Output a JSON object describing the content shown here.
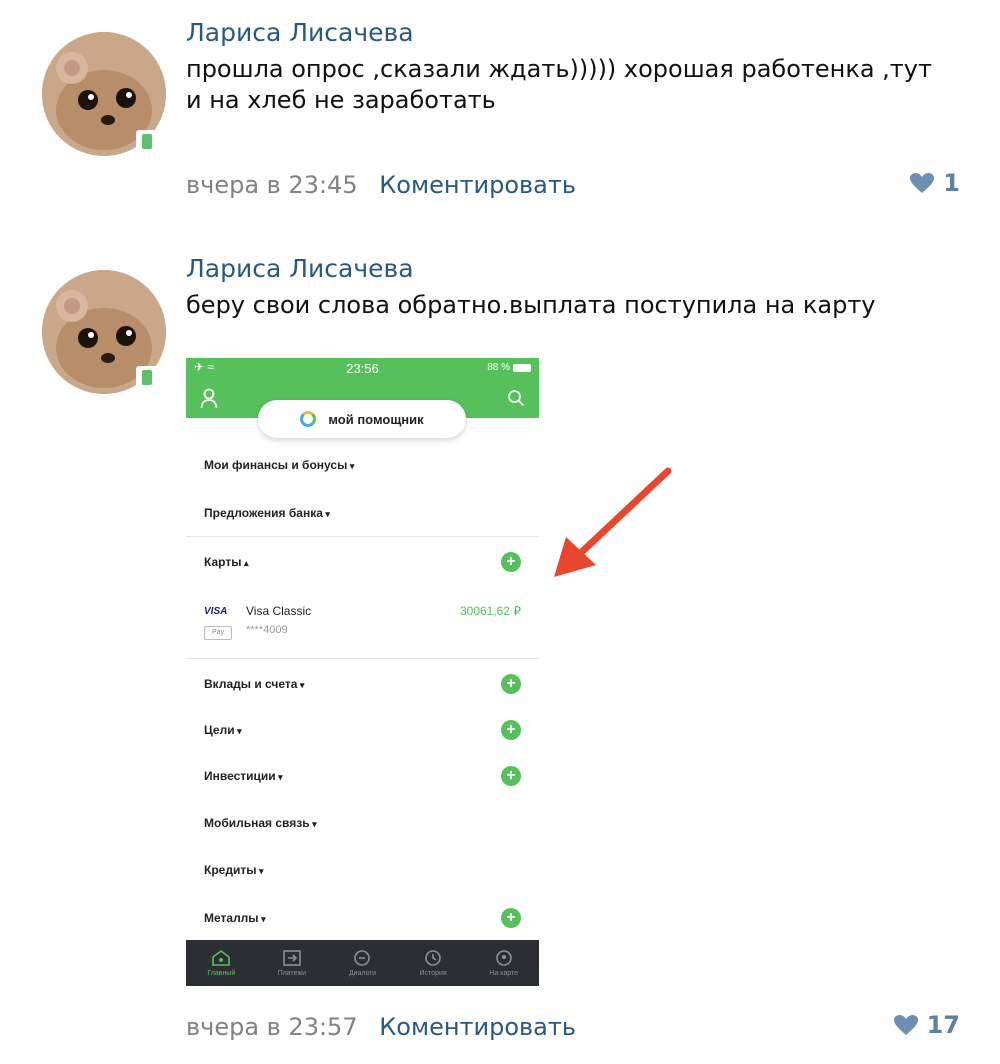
{
  "comments": [
    {
      "author": "Лариса Лисачева",
      "text_line1": "прошла опрос ,сказали ждать))))) хорошая работенка ,тут",
      "text_line2": "и на хлеб не заработать",
      "time": "вчера в 23:45",
      "reply": "Коментировать",
      "likes": "1"
    },
    {
      "author": "Лариса Лисачева",
      "text_line1": "беру свои слова обратно.выплата поступила на карту",
      "time": "вчера в 23:57",
      "reply": "Коментировать",
      "likes": "17"
    }
  ],
  "screenshot": {
    "status_time": "23:56",
    "status_battery": "88 %",
    "assistant": "мой помощник",
    "sections": {
      "finances": "Мои финансы и бонусы",
      "offers": "Предложения банка",
      "cards": "Карты",
      "deposits": "Вклады и счета",
      "goals": "Цели",
      "investments": "Инвестиции",
      "mobile": "Мобильная связь",
      "credits": "Кредиты",
      "metals": "Металлы"
    },
    "card": {
      "brand": "VISA",
      "pay": "Pay",
      "name": "Visa Classic",
      "number": "****4009",
      "amount": "30061,62 ₽"
    },
    "tabs": [
      "Главный",
      "Платежи",
      "Диалоги",
      "История",
      "На карте"
    ]
  },
  "colors": {
    "link": "#2a5885",
    "sber_green": "#56c15a",
    "arrow": "#e8472e"
  }
}
